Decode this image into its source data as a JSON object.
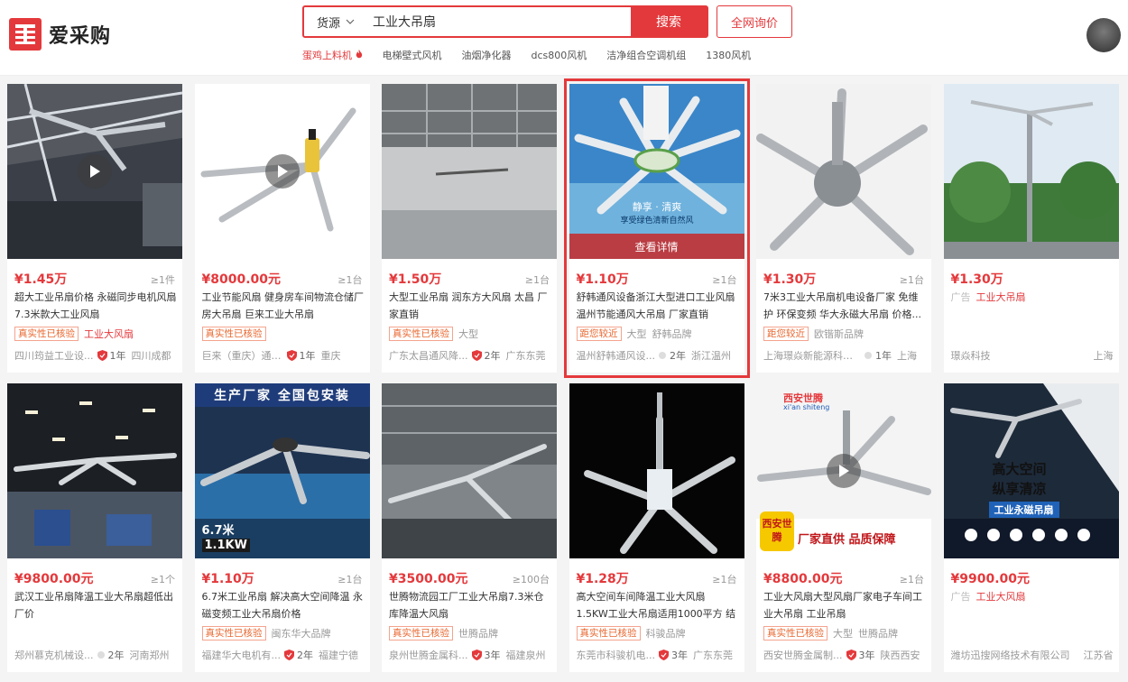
{
  "header": {
    "logo_text": "爱采购",
    "search_scope": "货源",
    "search_value": "工业大吊扇",
    "search_button": "搜索",
    "inquiry_button": "全网询价",
    "hot_links": [
      "蛋鸡上料机",
      "电梯壁式风机",
      "油烟净化器",
      "dcs800风机",
      "洁净组合空调机组",
      "1380风机"
    ]
  },
  "products": [
    {
      "price": "¥1.45万",
      "moq": "≥1件",
      "title": "超大工业吊扇价格 永磁同步电机风扇7.3米款大工业风扇",
      "tag": "真实性已核验",
      "attr": "工业大风扇",
      "shop": "四川筠益工业设...",
      "years": "1年",
      "location": "四川成都",
      "video": true
    },
    {
      "price": "¥8000.00元",
      "moq": "≥1台",
      "title": "工业节能风扇 健身房车间物流仓储厂房大吊扇 巨来工业大吊扇",
      "tag": "真实性已核验",
      "attr": "",
      "shop": "巨来（重庆）通风设...",
      "years": "1年",
      "location": "重庆",
      "video": true
    },
    {
      "price": "¥1.50万",
      "moq": "≥1台",
      "title": "大型工业吊扇 润东方大风扇 太昌 厂家直销",
      "tag": "真实性已核验",
      "attr": "大型",
      "shop": "广东太昌通风降...",
      "years": "2年",
      "location": "广东东莞",
      "video": false
    },
    {
      "price": "¥1.10万",
      "moq": "≥1台",
      "title": "舒韩通风设备浙江大型进口工业风扇 温州节能通风大吊扇 厂家直销",
      "tag": "距您较近",
      "attr": "大型",
      "attr2": "舒韩品牌",
      "shop": "温州舒韩通风设...",
      "years": "2年",
      "location": "浙江温州",
      "overlay": "查看详情",
      "banner1": "静享 · 清爽",
      "banner2": "享受绿色清新自然风",
      "selected": true
    },
    {
      "price": "¥1.30万",
      "moq": "≥1台",
      "title": "7米3工业大吊扇机电设备厂家 免维护 环保变频 华大永磁大吊扇 价格...",
      "tag": "距您较近",
      "attr": "欧锴斯品牌",
      "shop": "上海璟焱新能源科技...",
      "years": "1年",
      "location": "上海",
      "video": false
    },
    {
      "price": "¥1.30万",
      "moq": "",
      "title": "工业大吊扇",
      "ad_label": "广告",
      "tag": "",
      "attr": "",
      "shop": "璟焱科技",
      "years": "",
      "location": "上海",
      "video": false
    },
    {
      "price": "¥9800.00元",
      "moq": "≥1个",
      "title": "武汉工业吊扇降温工业大吊扇超低出厂价",
      "tag": "",
      "attr": "",
      "shop": "郑州慕克机械设...",
      "years": "2年",
      "location": "河南郑州",
      "video": false
    },
    {
      "price": "¥1.10万",
      "moq": "≥1台",
      "title": "6.7米工业吊扇 解决高大空间降温 永磁变频工业大吊扇价格",
      "tag": "真实性已核验",
      "attr": "闽东华大品牌",
      "shop": "福建华大电机有...",
      "years": "2年",
      "location": "福建宁德",
      "banner": "生产厂家  全国包安装",
      "size1": "6.7米",
      "size2": "1.1KW"
    },
    {
      "price": "¥3500.00元",
      "moq": "≥100台",
      "title": "世腾物流园工厂工业大吊扇7.3米仓库降温大风扇",
      "tag": "真实性已核验",
      "attr": "世腾品牌",
      "shop": "泉州世腾金属科...",
      "years": "3年",
      "location": "福建泉州",
      "video": false
    },
    {
      "price": "¥1.28万",
      "moq": "≥1台",
      "title": "高大空间车间降温工业大风扇 1.5KW工业大吊扇适用1000平方 结合环...",
      "tag": "真实性已核验",
      "attr": "科骏品牌",
      "shop": "东莞市科骏机电...",
      "years": "3年",
      "location": "广东东莞",
      "video": false
    },
    {
      "price": "¥8800.00元",
      "moq": "≥1台",
      "title": "工业大风扇大型风扇厂家电子车间工业大吊扇 工业吊扇",
      "tag": "真实性已核验",
      "attr": "大型",
      "attr2": "世腾品牌",
      "shop": "西安世腾金属制...",
      "years": "3年",
      "location": "陕西西安",
      "brand_cn": "西安世腾",
      "brand_en": "xi'an shiteng",
      "brand_badge": "西安世腾",
      "slogan": "厂家直供 品质保障",
      "video": true
    },
    {
      "price": "¥9900.00元",
      "moq": "",
      "title": "工业大风扇",
      "ad_label": "广告",
      "tag": "",
      "attr": "",
      "shop": "潍坊迅搜网络技术有限公司",
      "years": "",
      "location": "江苏省",
      "promo1": "高大空间",
      "promo2": "纵享清凉",
      "promo3": "工业永磁吊扇"
    }
  ],
  "colors": {
    "brand_red": "#e4393c",
    "tag_orange": "#e8672f",
    "price_red": "#e4393c"
  }
}
